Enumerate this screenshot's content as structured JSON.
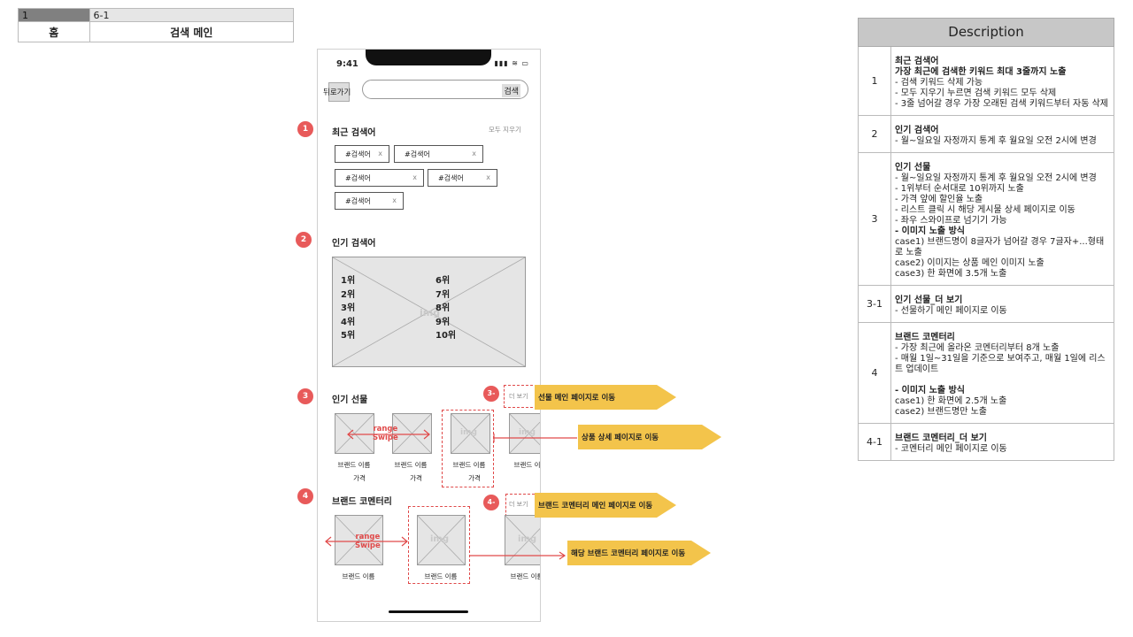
{
  "nav": {
    "page_num": "1",
    "page_code": "6-1",
    "crumb_home": "홈",
    "crumb_current": "검색 메인"
  },
  "phone": {
    "time": "9:41",
    "status": "▮▮▮ ≋ ▭",
    "back_label": "뒤로가기",
    "search_button": "검색",
    "recent_title": "최근 검색어",
    "clear_all": "모두 지우기",
    "chips": [
      "#검색어",
      "#검색어",
      "#검색어",
      "#검색어",
      "#검색어"
    ],
    "chip_x": "x",
    "popular_title": "인기 검색어",
    "img_label": "img",
    "ranks_left": [
      "1위",
      "2위",
      "3위",
      "4위",
      "5위"
    ],
    "ranks_right": [
      "6위",
      "7위",
      "8위",
      "9위",
      "10위"
    ],
    "gift_title": "인기 선물",
    "more_label": "더 보기",
    "brand_name": "브랜드 이름",
    "price": "가격",
    "range_swipe": [
      "range",
      "Swipe"
    ],
    "commentary_title": "브랜드 코멘터리"
  },
  "markers": [
    "1",
    "2",
    "3",
    "4",
    "3-",
    "4-"
  ],
  "callouts": {
    "gift_more": "선물 메인 페이지로 이동",
    "product_detail": "상품 상세 페이지로 이동",
    "commentary_more": "브랜드 코멘터리 메인 페이지로 이동",
    "commentary_detail": "해당 브랜드 코멘터리 페이지로 이동"
  },
  "description": {
    "header": "Description",
    "rows": [
      {
        "num": "1",
        "lines": [
          {
            "b": true,
            "t": "최근 검색어"
          },
          {
            "b": true,
            "t": "가장 최근에 검색한 키워드 최대 3줄까지 노출"
          },
          {
            "b": false,
            "t": "- 검색 키워드 삭제 가능"
          },
          {
            "b": false,
            "t": "- 모두 지우기 누르면 검색 키워드 모두 삭제"
          },
          {
            "b": false,
            "t": "- 3줄 넘어갈 경우 가장 오래된 검색 키워드부터 자동 삭제"
          }
        ]
      },
      {
        "num": "2",
        "lines": [
          {
            "b": true,
            "t": "인기 검색어"
          },
          {
            "b": false,
            "t": "- 월~일요일 자정까지 통계 후 월요일 오전 2시에 변경"
          }
        ]
      },
      {
        "num": "3",
        "lines": [
          {
            "b": true,
            "t": "인기 선물"
          },
          {
            "b": false,
            "t": "- 월~일요일 자정까지 통계 후 월요일 오전 2시에 변경"
          },
          {
            "b": false,
            "t": "- 1위부터 순서대로 10위까지 노출"
          },
          {
            "b": false,
            "t": "- 가격 앞에 할인율 노출"
          },
          {
            "b": false,
            "t": "- 리스트 클릭 시 해당 게시물 상세 페이지로 이동"
          },
          {
            "b": false,
            "t": "- 좌우 스와이프로 넘기기 가능"
          },
          {
            "b": true,
            "t": "- 이미지 노출 방식"
          },
          {
            "b": false,
            "t": "case1) 브랜드명이 8글자가 넘어갈 경우 7글자+...형태로 노출"
          },
          {
            "b": false,
            "t": "case2) 이미지는 상품 메인 이미지 노출"
          },
          {
            "b": false,
            "t": "case3) 한 화면에 3.5개 노출"
          }
        ]
      },
      {
        "num": "3-1",
        "lines": [
          {
            "b": true,
            "t": "인기 선물_더 보기"
          },
          {
            "b": false,
            "t": "- 선물하기 메인 페이지로 이동"
          }
        ]
      },
      {
        "num": "4",
        "lines": [
          {
            "b": true,
            "t": "브랜드 코멘터리"
          },
          {
            "b": false,
            "t": "- 가장 최근에 올라온 코멘터리부터 8개 노출"
          },
          {
            "b": false,
            "t": "- 매월 1일~31일을 기준으로 보여주고, 매월 1일에 리스트 업데이트"
          },
          {
            "b": false,
            "t": " "
          },
          {
            "b": true,
            "t": "- 이미지 노출 방식"
          },
          {
            "b": false,
            "t": "case1)  한 화면에 2.5개 노출"
          },
          {
            "b": false,
            "t": "case2)  브랜드명만 노출"
          }
        ]
      },
      {
        "num": "4-1",
        "lines": [
          {
            "b": true,
            "t": "브랜드 코멘터리_더 보기"
          },
          {
            "b": false,
            "t": "- 코멘터리 메인 페이지로 이동"
          }
        ]
      }
    ]
  }
}
